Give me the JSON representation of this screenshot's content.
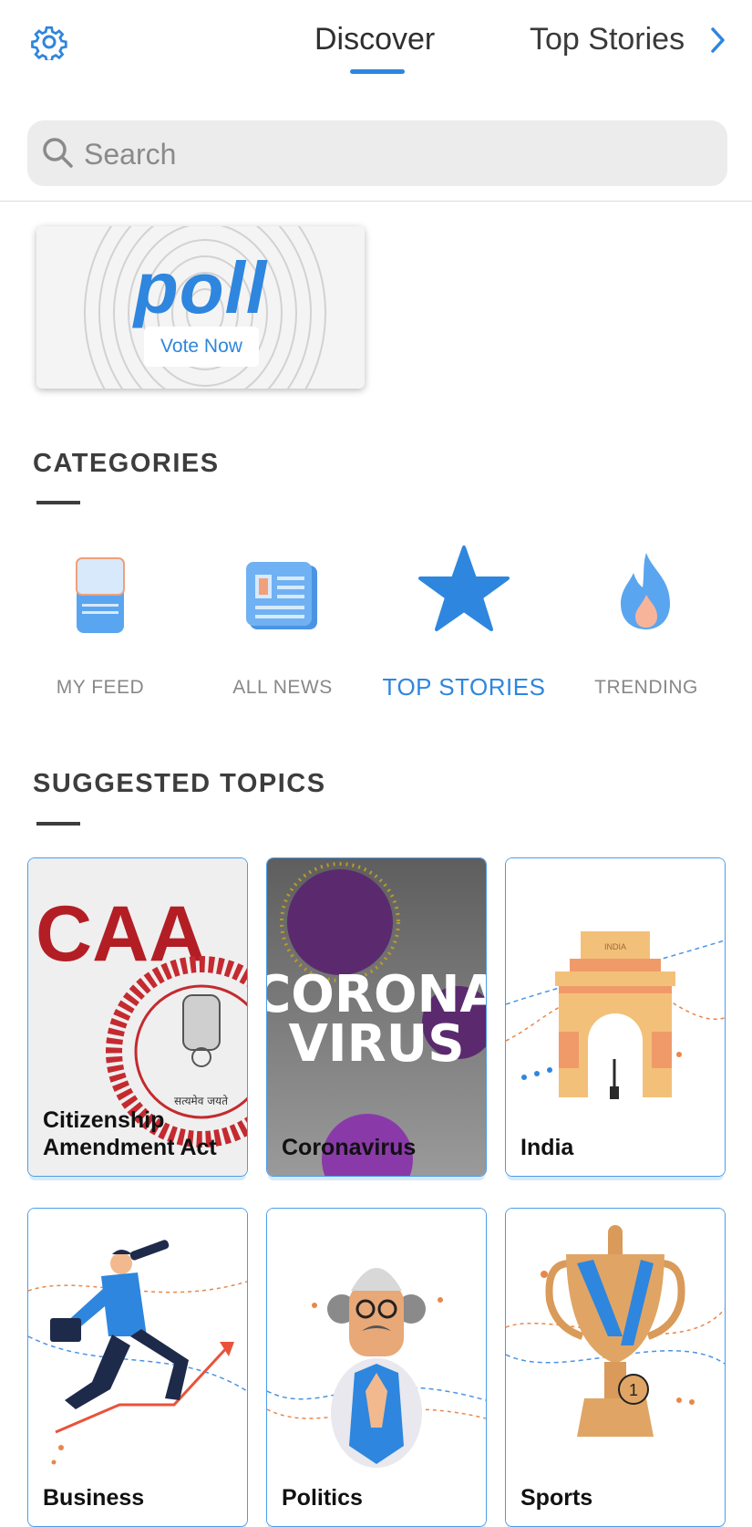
{
  "header": {
    "tabs": [
      {
        "label": "Discover",
        "active": true
      },
      {
        "label": "Top Stories",
        "active": false
      }
    ],
    "icons": {
      "settings": "gear-icon",
      "next": "chevron-right-icon"
    }
  },
  "search": {
    "placeholder": "Search"
  },
  "poll": {
    "title": "poll",
    "button_label": "Vote Now"
  },
  "categories": {
    "title": "CATEGORIES",
    "items": [
      {
        "label": "MY FEED",
        "icon": "feed-icon",
        "active": false
      },
      {
        "label": "ALL NEWS",
        "icon": "newspaper-icon",
        "active": false
      },
      {
        "label": "TOP STORIES",
        "icon": "star-icon",
        "active": true
      },
      {
        "label": "TRENDING",
        "icon": "flame-icon",
        "active": false
      }
    ]
  },
  "suggested": {
    "title": "SUGGESTED TOPICS",
    "topics": [
      {
        "label": "Citizenship\nAmendment Act",
        "image_text": "CAA",
        "emblem_text": "सत्यमेव जयते"
      },
      {
        "label": "Coronavirus",
        "image_text_line1": "CORONA",
        "image_text_line2": "VIRUS"
      },
      {
        "label": "India",
        "image_text": "INDIA"
      },
      {
        "label": "Business"
      },
      {
        "label": "Politics"
      },
      {
        "label": "Sports",
        "image_text": "1"
      }
    ]
  },
  "colors": {
    "accent": "#2e86de",
    "caa_red": "#b31e24",
    "card_border": "#4a9de8"
  }
}
